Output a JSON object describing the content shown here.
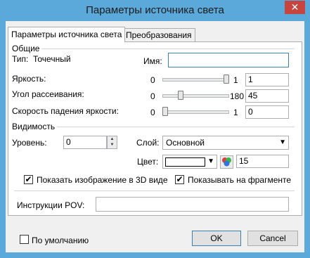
{
  "window": {
    "title": "Параметры источника света",
    "close_glyph": "✕"
  },
  "tabs": [
    {
      "label": "Параметры источника света",
      "active": true
    },
    {
      "label": "Преобразования",
      "active": false
    }
  ],
  "general": {
    "section_label": "Общие",
    "type_label": "Тип:",
    "type_value": "Точечный",
    "name_label": "Имя:",
    "name_value": ""
  },
  "brightness": {
    "label": "Яркость:",
    "min": "0",
    "max": "1",
    "value": "1",
    "level": 1.0
  },
  "spread": {
    "label": "Угол рассеивания:",
    "min": "0",
    "max": "180",
    "value": "45",
    "level": 0.25
  },
  "falloff": {
    "label": "Скорость падения яркости:",
    "min": "0",
    "max": "1",
    "value": "0",
    "level": 0.0
  },
  "visibility": {
    "section_label": "Видимость",
    "level_label": "Уровень:",
    "level_value": "0",
    "layer_label": "Слой:",
    "layer_value": "Основной",
    "color_label": "Цвет:",
    "color_swatch": "#ffffff",
    "color_number": "15",
    "show_3d_label": "Показать изображение в 3D виде",
    "show_3d_checked": true,
    "show_fragment_label": "Показывать  на фрагменте",
    "show_fragment_checked": true
  },
  "pov": {
    "label": "Инструкции POV:",
    "value": ""
  },
  "footer": {
    "default_label": "По умолчанию",
    "default_checked": false,
    "ok_label": "OK",
    "cancel_label": "Cancel"
  },
  "check_glyph": "✔",
  "colors": {
    "titlebar": "#5aa9da",
    "close": "#c7453e",
    "focus_border": "#3c7fb1"
  }
}
